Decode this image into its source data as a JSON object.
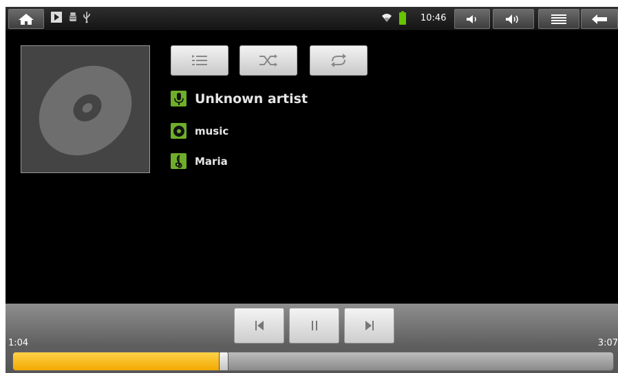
{
  "status_bar": {
    "time": "10:46",
    "icons": [
      "home-icon",
      "play-status-icon",
      "android-debug-icon",
      "usb-icon",
      "wifi-icon",
      "battery-icon",
      "volume-down-icon",
      "volume-up-icon",
      "menu-icon",
      "back-icon"
    ]
  },
  "mode_buttons": [
    "playlist-icon",
    "shuffle-icon",
    "repeat-icon"
  ],
  "track": {
    "artist": "Unknown artist",
    "album": "music",
    "title": "Maria"
  },
  "playback": {
    "elapsed": "1:04",
    "duration": "3:07",
    "progress": 0.35
  },
  "colors": {
    "accent_green": "#6fae2a",
    "progress": "#f2a900"
  }
}
